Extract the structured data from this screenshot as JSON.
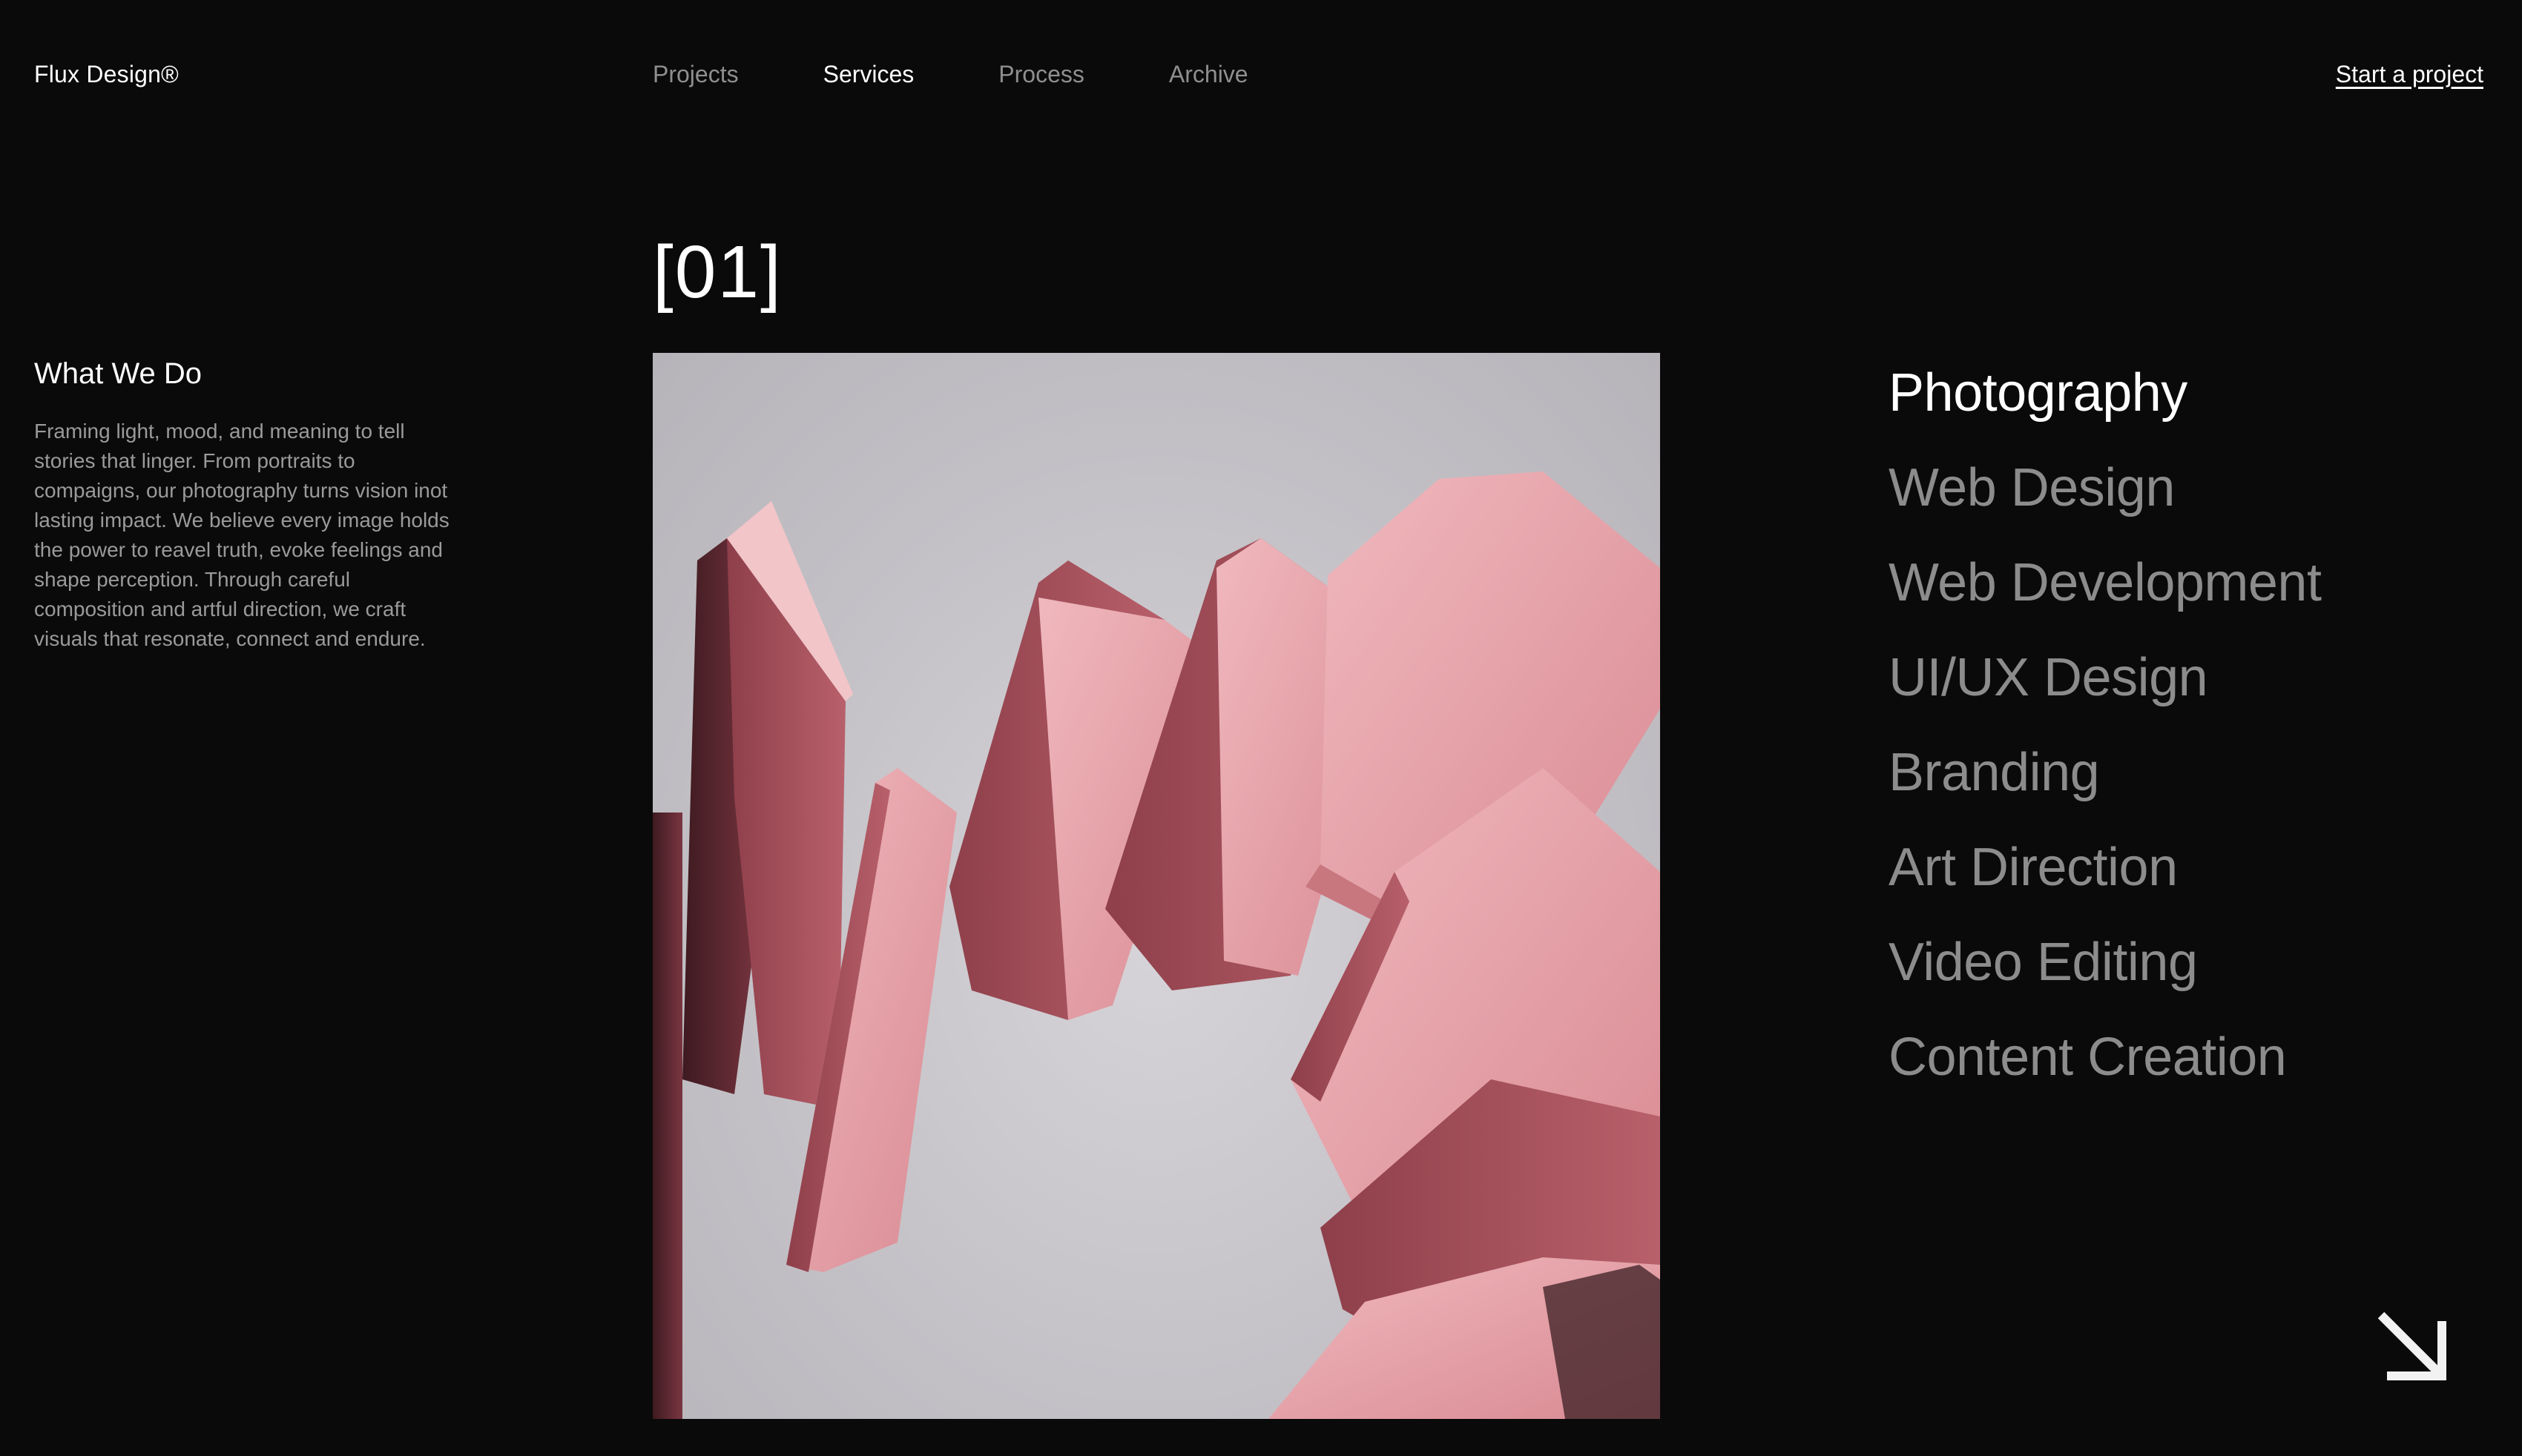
{
  "header": {
    "brand": "Flux Design®",
    "nav": [
      {
        "label": "Projects",
        "active": false
      },
      {
        "label": "Services",
        "active": true
      },
      {
        "label": "Process",
        "active": false
      },
      {
        "label": "Archive",
        "active": false
      }
    ],
    "cta_label": "Start a project"
  },
  "intro": {
    "title": "What We Do",
    "body": "Framing light, mood, and meaning to tell stories that linger. From portraits to compaigns, our photography turns vision inot lasting impact. We believe every image holds the power to reavel truth, evoke feelings and shape perception. Through careful composition and artful direction, we craft visuals that resonate, connect and endure."
  },
  "counter": "[01]",
  "services": [
    {
      "label": "Photography",
      "active": true
    },
    {
      "label": "Web Design",
      "active": false
    },
    {
      "label": "Web Development",
      "active": false
    },
    {
      "label": "UI/UX Design",
      "active": false
    },
    {
      "label": "Branding",
      "active": false
    },
    {
      "label": "Art Direction",
      "active": false
    },
    {
      "label": "Video Editing",
      "active": false
    },
    {
      "label": "Content Creation",
      "active": false
    }
  ],
  "colors": {
    "background": "#0a0a0a",
    "text": "#ffffff",
    "muted": "#8c8c8c",
    "accent_pink": "#d9878f"
  },
  "icons": {
    "next": "arrow-down-right-icon"
  }
}
